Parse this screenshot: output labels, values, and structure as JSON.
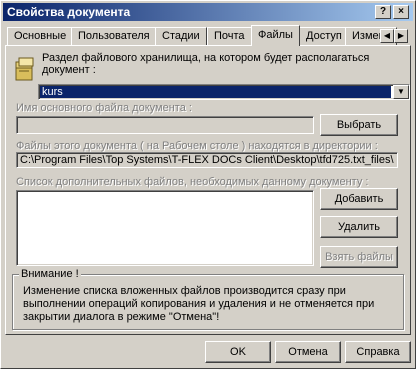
{
  "window": {
    "title": "Свойства документа"
  },
  "tabs": [
    {
      "label": "Основные"
    },
    {
      "label": "Пользователя"
    },
    {
      "label": "Стадии"
    },
    {
      "label": "Почта"
    },
    {
      "label": "Файлы"
    },
    {
      "label": "Доступ"
    },
    {
      "label": "Изменения"
    }
  ],
  "storage": {
    "label": "Раздел файлового хранилища, на котором будет располагаться документ :",
    "selected": "kurs",
    "icon": "folder-icon"
  },
  "main_file": {
    "label": "Имя основного файла документа :",
    "value": "",
    "browse_button": "Выбрать"
  },
  "directory": {
    "label": "Файлы этого документа ( на Рабочем  столе ) находятся в директории :",
    "path": "C:\\Program Files\\Top Systems\\T-FLEX DOCs Client\\Desktop\\tfd725.txt_files\\"
  },
  "additional": {
    "label": "Список дополнительных файлов, необходимых данному документу :",
    "items": [],
    "add_button": "Добавить",
    "remove_button": "Удалить",
    "take_button": "Взять файлы"
  },
  "warning": {
    "title": "Внимание !",
    "text": "Изменение списка вложенных файлов производится сразу при выполнении операций копирования и удаления и не отменяется при закрытии диалога в режиме \"Отмена\"!"
  },
  "footer": {
    "ok": "OK",
    "cancel": "Отмена",
    "help": "Справка"
  },
  "colors": {
    "titlebar_start": "#0a246a",
    "titlebar_end": "#a6caf0",
    "selection": "#0a246a",
    "face": "#d4d0c8"
  }
}
